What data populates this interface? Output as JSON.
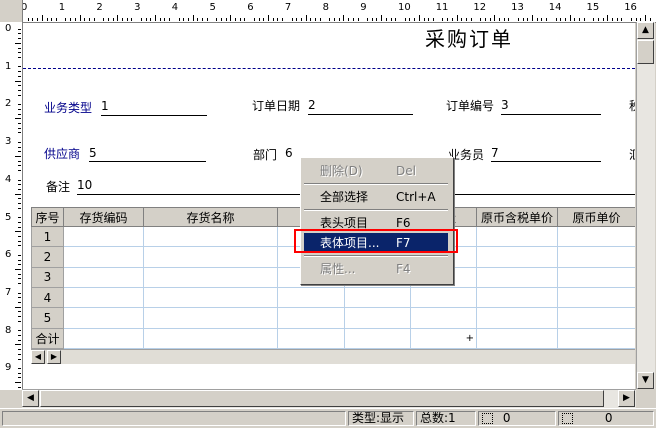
{
  "ruler": {
    "top_labels": [
      "0",
      "1",
      "2",
      "3",
      "4",
      "5",
      "6",
      "7",
      "8",
      "9",
      "10",
      "11",
      "12",
      "13",
      "14",
      "15",
      "16"
    ],
    "left_labels": [
      "0",
      "1",
      "2",
      "3",
      "4",
      "5",
      "6",
      "7",
      "8",
      "9"
    ]
  },
  "document": {
    "title": "采购订单",
    "fields": {
      "business_type": {
        "label": "业务类型",
        "value": "1"
      },
      "order_date": {
        "label": "订单日期",
        "value": "2"
      },
      "order_number": {
        "label": "订单编号",
        "value": "3"
      },
      "tax_truncated": {
        "label": "税"
      },
      "supplier": {
        "label": "供应商",
        "value": "5"
      },
      "department": {
        "label": "部门",
        "value": "6"
      },
      "salesperson": {
        "label": "业务员",
        "value": "7"
      },
      "truncated_right": {
        "label": "汇"
      },
      "remark": {
        "label": "备注",
        "value": "10"
      }
    },
    "grid": {
      "columns": [
        "序号",
        "存货编码",
        "存货名称",
        "规",
        "",
        "量",
        "原币含税单价",
        "原币单价"
      ],
      "row_numbers": [
        "1",
        "2",
        "3",
        "4",
        "5"
      ],
      "total_label": "合计",
      "total_mark": "+"
    }
  },
  "context_menu": {
    "items": [
      {
        "label": "删除(D)",
        "shortcut": "Del",
        "disabled": true
      },
      {
        "label": "全部选择",
        "shortcut": "Ctrl+A",
        "disabled": false
      },
      {
        "label": "表头项目",
        "shortcut": "F6",
        "disabled": false
      },
      {
        "label": "表体项目...",
        "shortcut": "F7",
        "disabled": false,
        "selected": true
      },
      {
        "label": "属性...",
        "shortcut": "F4",
        "disabled": true
      }
    ]
  },
  "status_bar": {
    "type": "类型:显示",
    "total": "总数:1",
    "value1": "0",
    "value2": "0"
  },
  "colors": {
    "highlight": "#0a246a",
    "annotation_box": "#ff0000",
    "field_label_blue": "#00008b"
  }
}
